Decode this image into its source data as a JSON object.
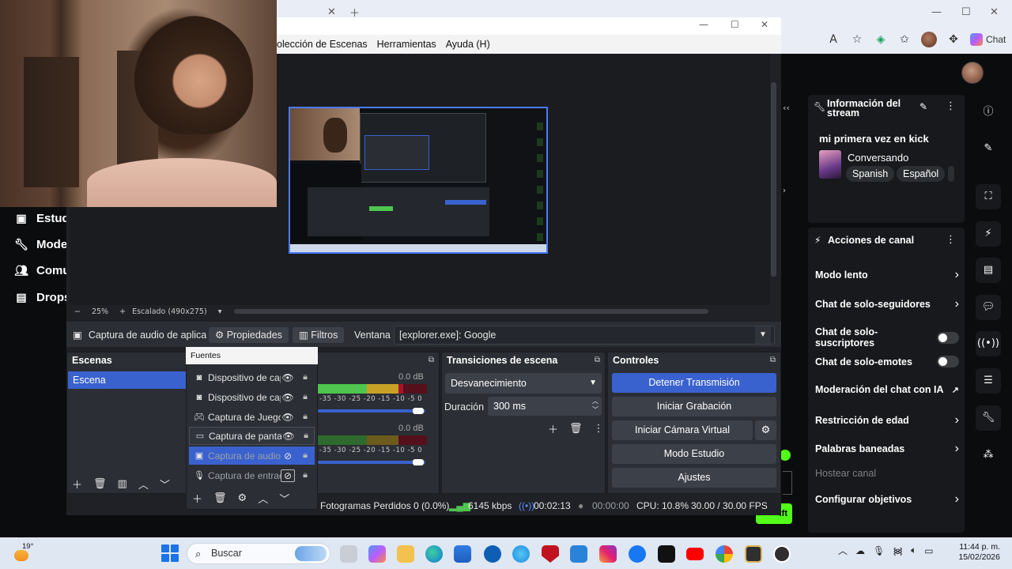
{
  "obs": {
    "menu": [
      "olección de Escenas",
      "Herramientas",
      "Ayuda (H)"
    ],
    "zoom": {
      "minus": "−",
      "value": "25%",
      "plus": "+",
      "scale_label": "Escalado (490x275)"
    },
    "source_toolbar": {
      "source_name": "Captura de audio de aplica",
      "properties": "Propiedades",
      "filters": "Filtros",
      "window_label": "Ventana",
      "window_value": "[explorer.exe]: Google"
    },
    "scenes": {
      "title": "Escena",
      "title_full": "Escenas",
      "items": [
        "Escena"
      ]
    },
    "sources": {
      "title": "Fuentes",
      "items": [
        {
          "icon": "camera-icon",
          "name": "Dispositivo de cap",
          "visible": true,
          "state": "normal"
        },
        {
          "icon": "camera-icon",
          "name": "Dispositivo de cap",
          "visible": true,
          "state": "normal"
        },
        {
          "icon": "gamepad-icon",
          "name": "Captura de Juego",
          "visible": true,
          "state": "normal"
        },
        {
          "icon": "monitor-icon",
          "name": "Captura de panta",
          "visible": true,
          "state": "hover"
        },
        {
          "icon": "app-audio-icon",
          "name": "Captura de audio",
          "visible": false,
          "state": "selected"
        },
        {
          "icon": "microphone-icon",
          "name": "Captura de entrac",
          "visible": false,
          "state": "hidden"
        }
      ]
    },
    "mixer": {
      "channels": [
        {
          "db": "0.0 dB",
          "ticks": "-35 -30 -25 -20 -15 -10 -5 0"
        },
        {
          "db": "0.0 dB",
          "ticks": "-35 -30 -25 -20 -15 -10 -5 0"
        }
      ]
    },
    "transitions": {
      "title": "Transiciones de escena",
      "selected": "Desvanecimiento",
      "duration_label": "Duración",
      "duration_value": "300 ms"
    },
    "controls": {
      "title": "Controles",
      "stop_stream": "Detener Transmisión",
      "start_recording": "Iniciar Grabación",
      "start_vcam": "Iniciar Cámara Virtual",
      "studio_mode": "Modo Estudio",
      "settings": "Ajustes"
    },
    "status": {
      "dropped_frames": "Fotogramas Perdidos 0 (0.0%)",
      "bitrate": "6145 kbps",
      "stream_time": "00:02:13",
      "rec_time": "00:00:00",
      "cpu": "CPU: 10.8%",
      "fps": "30.00 / 30.00 FPS"
    }
  },
  "kick": {
    "left_nav": [
      {
        "icon": "studio-icon",
        "label": "Estud"
      },
      {
        "icon": "wrench-icon",
        "label": "Mode"
      },
      {
        "icon": "community-icon",
        "label": "Comu"
      },
      {
        "icon": "drops-icon",
        "label": "Drops"
      }
    ],
    "stream_info": {
      "title": "Información del stream",
      "stream_title": "mi primera vez en kick",
      "category": "Conversando",
      "tags": [
        "Spanish",
        "Español"
      ]
    },
    "channel_actions": {
      "title": "Acciones de canal",
      "items": [
        {
          "label": "Modo lento",
          "control": "chevron"
        },
        {
          "label": "Chat de solo-seguidores",
          "control": "chevron"
        },
        {
          "label": "Chat de solo-suscriptores",
          "control": "toggle"
        },
        {
          "label": "Chat de solo-emotes",
          "control": "toggle"
        },
        {
          "label": "Moderación del chat con IA",
          "control": "external"
        },
        {
          "label": "Restricción de edad",
          "control": "chevron"
        },
        {
          "label": "Palabras baneadas",
          "control": "chevron"
        },
        {
          "label": "Hostear canal",
          "control": "none"
        },
        {
          "label": "Configurar objetivos",
          "control": "chevron"
        }
      ]
    },
    "go_live_fragment": "ift"
  },
  "browser": {
    "chat_label": "Chat"
  },
  "taskbar": {
    "weather": "19°",
    "search_placeholder": "Buscar",
    "time": "11:44 p. m.",
    "date": "15/02/2026"
  },
  "colors": {
    "accent_blue": "#3a62ce",
    "kick_green": "#53fc18",
    "obs_bg": "#1f2126",
    "dock_bg": "#2b2e35"
  }
}
